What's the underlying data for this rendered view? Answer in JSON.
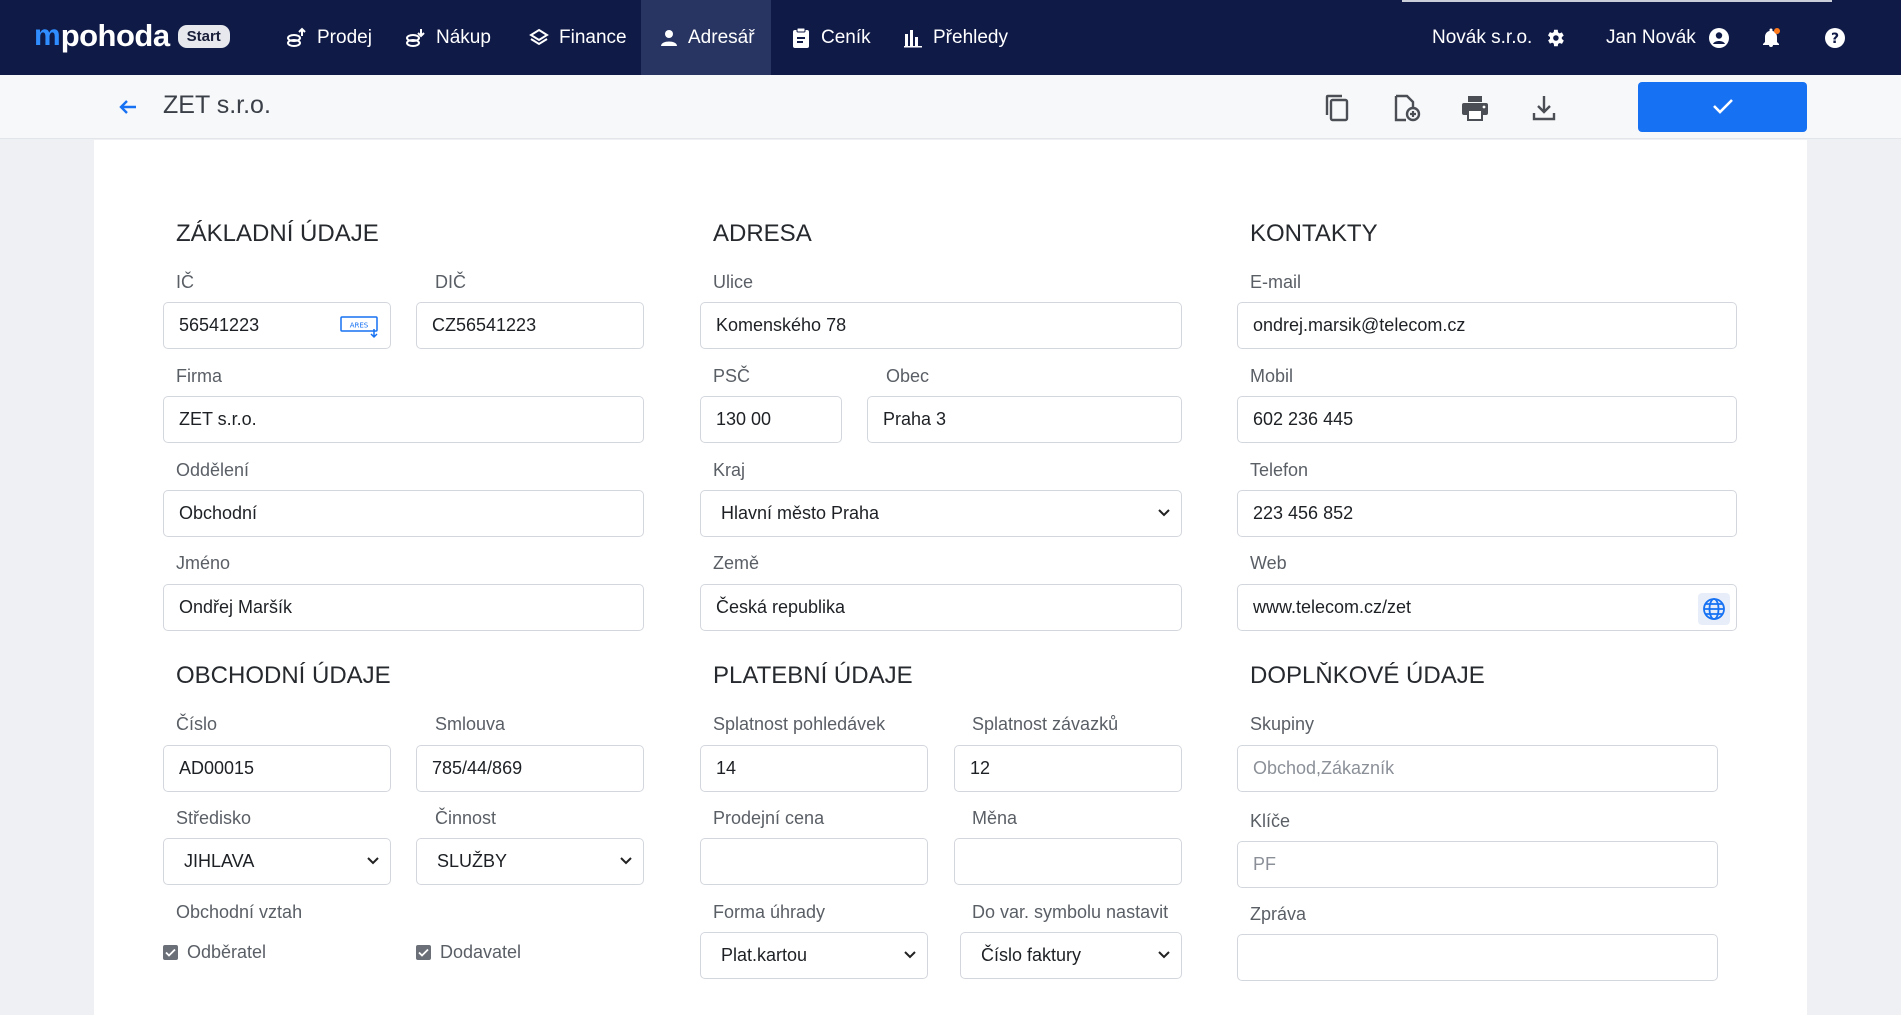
{
  "nav": {
    "logo_mark": "m",
    "logo_word": "pohoda",
    "logo_badge": "Start",
    "items": [
      {
        "label": "Prodej",
        "icon": "sales-icon"
      },
      {
        "label": "Nákup",
        "icon": "purchase-icon"
      },
      {
        "label": "Finance",
        "icon": "finance-icon"
      },
      {
        "label": "Adresář",
        "icon": "person-icon"
      },
      {
        "label": "Ceník",
        "icon": "clipboard-icon"
      },
      {
        "label": "Přehledy",
        "icon": "bar-chart-icon"
      }
    ],
    "active": "Adresář",
    "company": "Novák s.r.o.",
    "user": "Jan Novák"
  },
  "toolbar": {
    "title": "ZET s.r.o."
  },
  "sections": {
    "basic": {
      "title": "ZÁKLADNÍ ÚDAJE",
      "ic_label": "IČ",
      "ic_value": "56541223",
      "ares_label": "ARES",
      "dic_label": "DIČ",
      "dic_value": "CZ56541223",
      "firma_label": "Firma",
      "firma_value": "ZET s.r.o.",
      "oddeleni_label": "Oddělení",
      "oddeleni_value": "Obchodní",
      "jmeno_label": "Jméno",
      "jmeno_value": "Ondřej Maršík"
    },
    "address": {
      "title": "ADRESA",
      "ulice_label": "Ulice",
      "ulice_value": "Komenského 78",
      "psc_label": "PSČ",
      "psc_value": "130 00",
      "obec_label": "Obec",
      "obec_value": "Praha 3",
      "kraj_label": "Kraj",
      "kraj_value": "Hlavní město Praha",
      "zeme_label": "Země",
      "zeme_value": "Česká republika"
    },
    "contacts": {
      "title": "KONTAKTY",
      "email_label": "E-mail",
      "email_value": "ondrej.marsik@telecom.cz",
      "mobil_label": "Mobil",
      "mobil_value": "602 236 445",
      "telefon_label": "Telefon",
      "telefon_value": "223 456 852",
      "web_label": "Web",
      "web_value": "www.telecom.cz/zet"
    },
    "business": {
      "title": "OBCHODNÍ ÚDAJE",
      "cislo_label": "Číslo",
      "cislo_value": "AD00015",
      "smlouva_label": "Smlouva",
      "smlouva_value": "785/44/869",
      "stredisko_label": "Středisko",
      "stredisko_value": "JIHLAVA",
      "cinnost_label": "Činnost",
      "cinnost_value": "SLUŽBY",
      "vztah_label": "Obchodní vztah",
      "odberatel_label": "Odběratel",
      "dodavatel_label": "Dodavatel"
    },
    "payment": {
      "title": "PLATEBNÍ ÚDAJE",
      "splat_pohl_label": "Splatnost pohledávek",
      "splat_pohl_value": "14",
      "splat_zav_label": "Splatnost závazků",
      "splat_zav_value": "12",
      "prodejni_label": "Prodejní cena",
      "prodejni_value": "",
      "mena_label": "Měna",
      "mena_value": "",
      "forma_label": "Forma úhrady",
      "forma_value": "Plat.kartou",
      "varsym_label": "Do var. symbolu nastavit",
      "varsym_value": "Číslo faktury"
    },
    "extra": {
      "title": "DOPLŇKOVÉ ÚDAJE",
      "skupiny_label": "Skupiny",
      "skupiny_placeholder": "Obchod,Zákazník",
      "klice_label": "Klíče",
      "klice_placeholder": "PF",
      "zprava_label": "Zpráva",
      "zprava_value": ""
    }
  },
  "colors": {
    "nav_bg": "#0f1a47",
    "nav_active": "#283562",
    "primary": "#1672f3",
    "accent_logo": "#2f8dff"
  }
}
